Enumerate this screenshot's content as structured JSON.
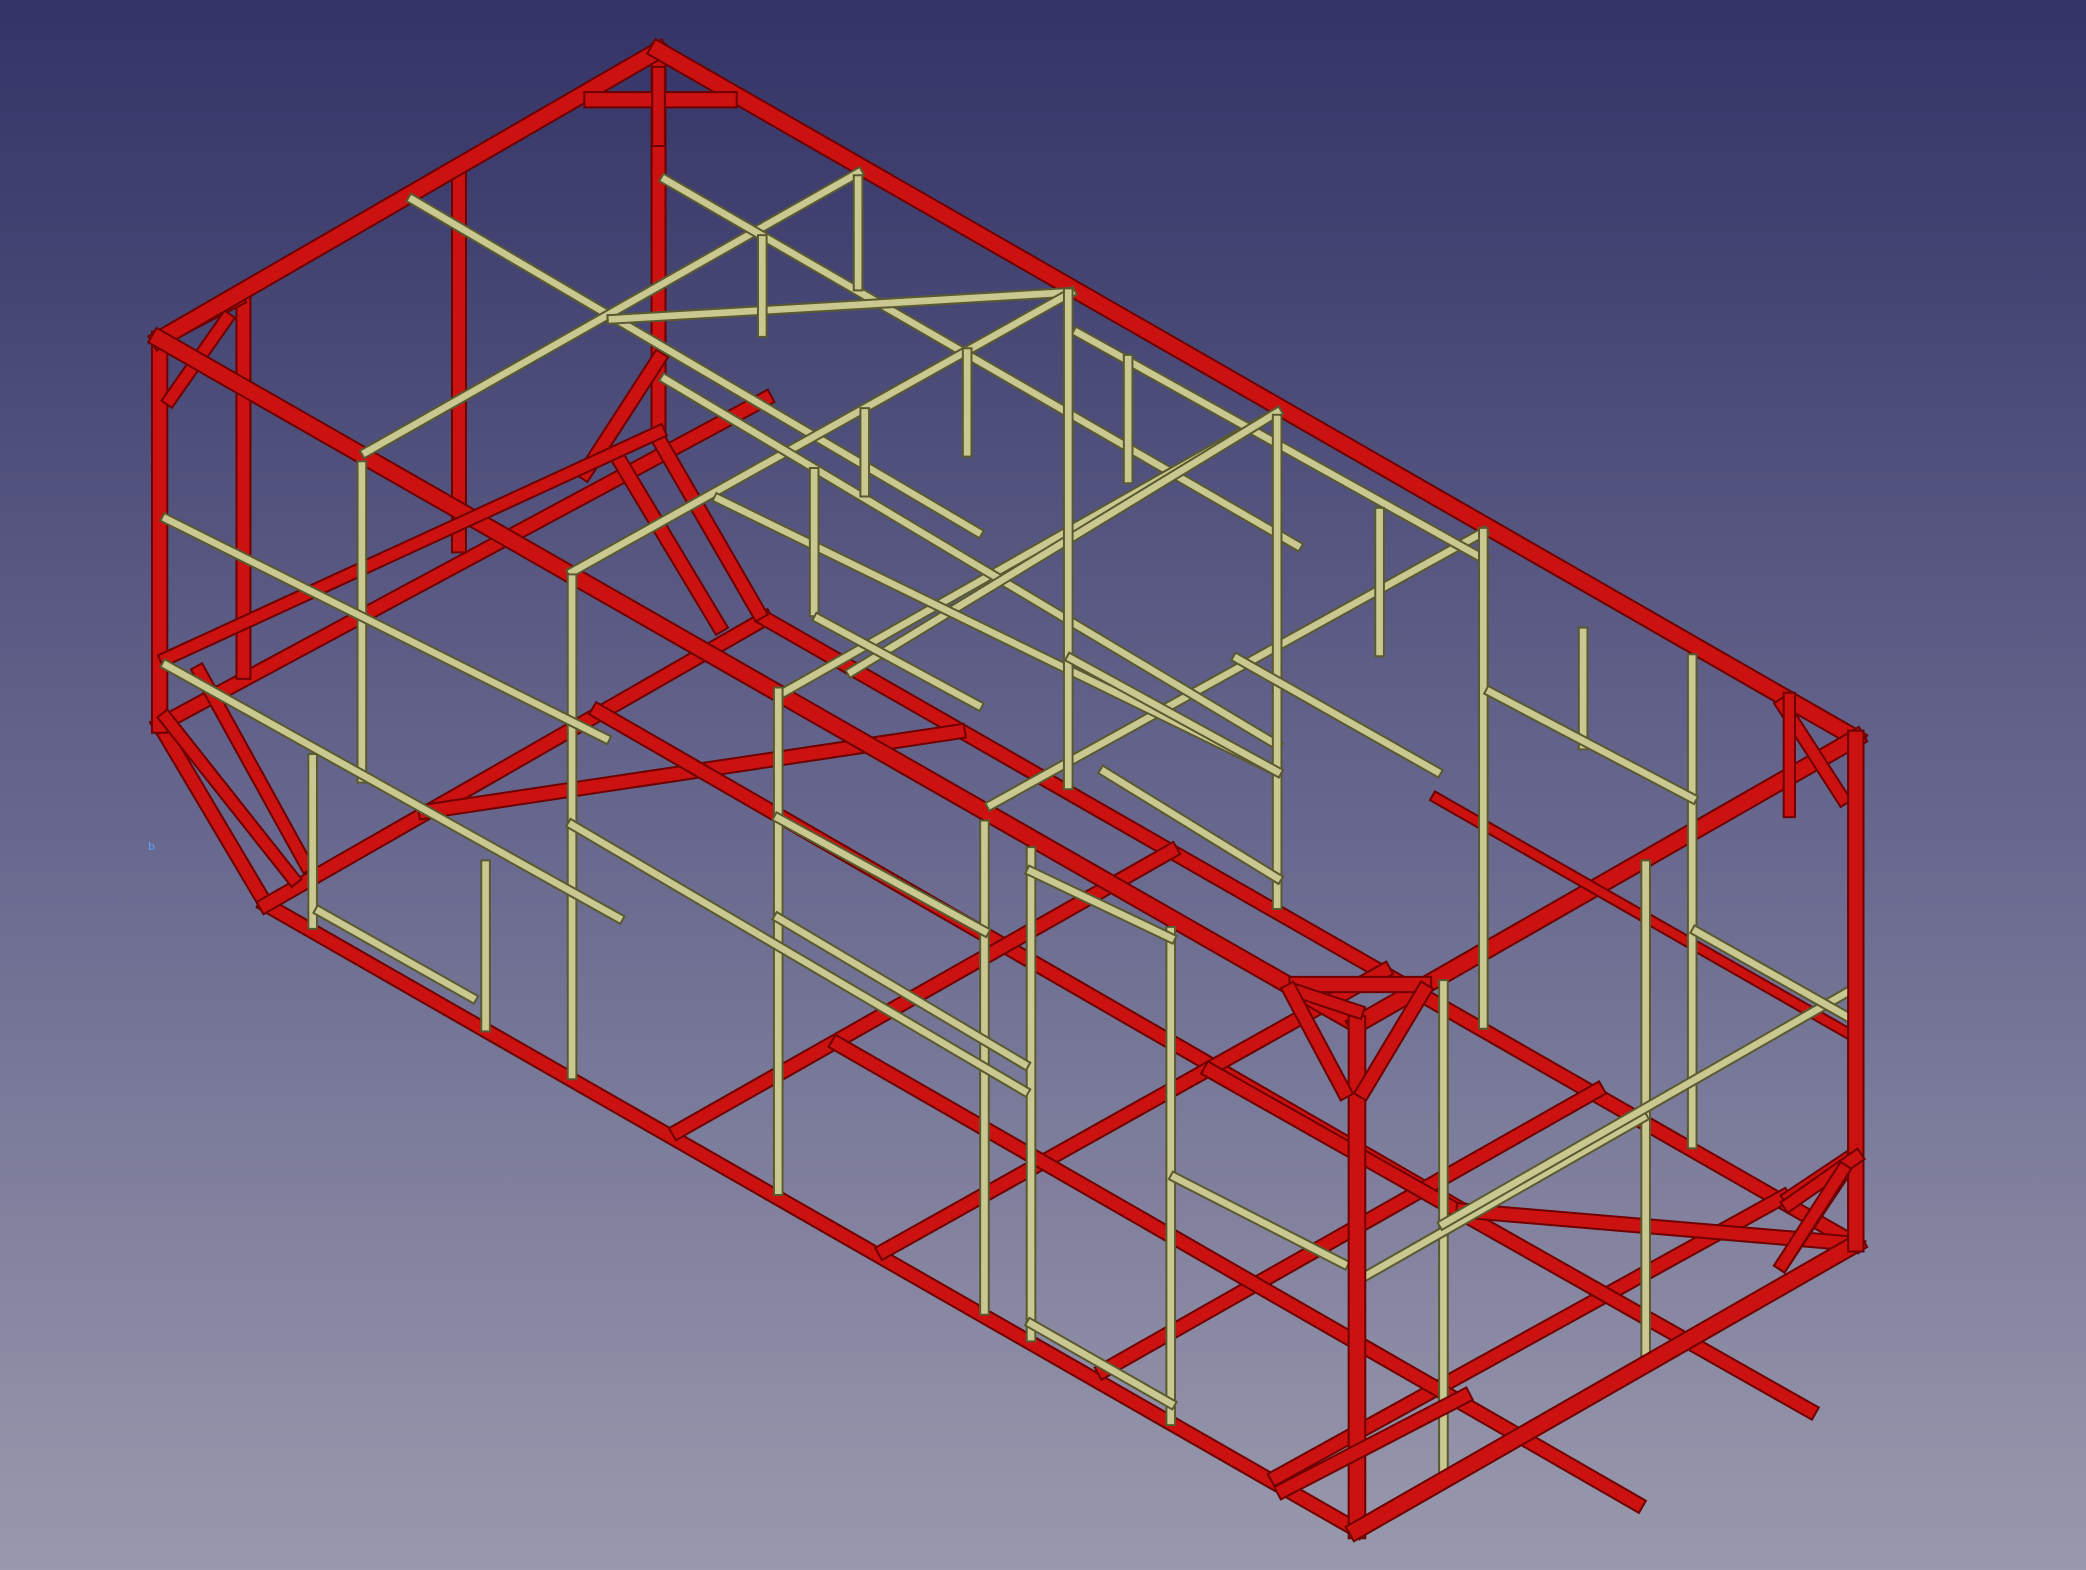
{
  "view": {
    "background_top": "#333366",
    "background_bottom": "#9999ad"
  },
  "colors": {
    "steel_frame": "#cc1111",
    "steel_frame_dark": "#6e0000",
    "timber_studs": "#c8c890",
    "timber_studs_dark": "#5a5a30"
  },
  "marker_label": "b"
}
